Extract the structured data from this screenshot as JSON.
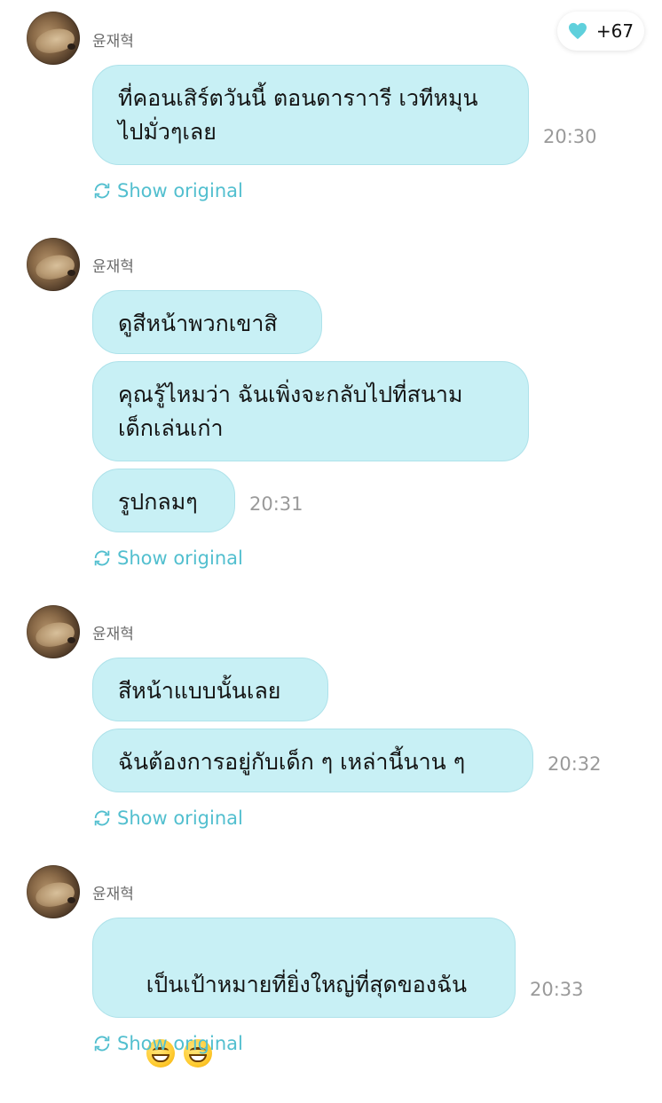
{
  "likes": {
    "icon": "heart-icon",
    "count": "+67",
    "color": "#5fd0dc"
  },
  "messages": [
    {
      "author": "윤재혁",
      "bubbles": [
        "ที่คอนเสิร์ตวันนี้ ตอนดาราารี เวทีหมุน\nไปมั่วๆเลย"
      ],
      "time": "20:30",
      "show_original": "Show original"
    },
    {
      "author": "윤재혁",
      "bubbles": [
        "ดูสีหน้าพวกเขาสิ",
        "คุณรู้ไหมว่า ฉันเพิ่งจะกลับไปที่สนาม\nเด็กเล่นเก่า",
        "รูปกลมๆ"
      ],
      "time": "20:31",
      "show_original": "Show original"
    },
    {
      "author": "윤재혁",
      "bubbles": [
        "สีหน้าแบบนั้นเลย",
        "ฉันต้องการอยู่กับเด็ก ๆ เหล่านี้นาน ๆ"
      ],
      "time": "20:32",
      "show_original": "Show original"
    },
    {
      "author": "윤재혁",
      "bubbles": [
        "เป็นเป้าหมายที่ยิ่งใหญ่ที่สุดของฉัน"
      ],
      "emojis": [
        "grinning-face-emoji",
        "grinning-face-emoji"
      ],
      "time": "20:33",
      "show_original": "Show original"
    }
  ],
  "colors": {
    "bubble": "#c8f0f5",
    "accent": "#52bfcf",
    "time": "#9a9a9a"
  }
}
